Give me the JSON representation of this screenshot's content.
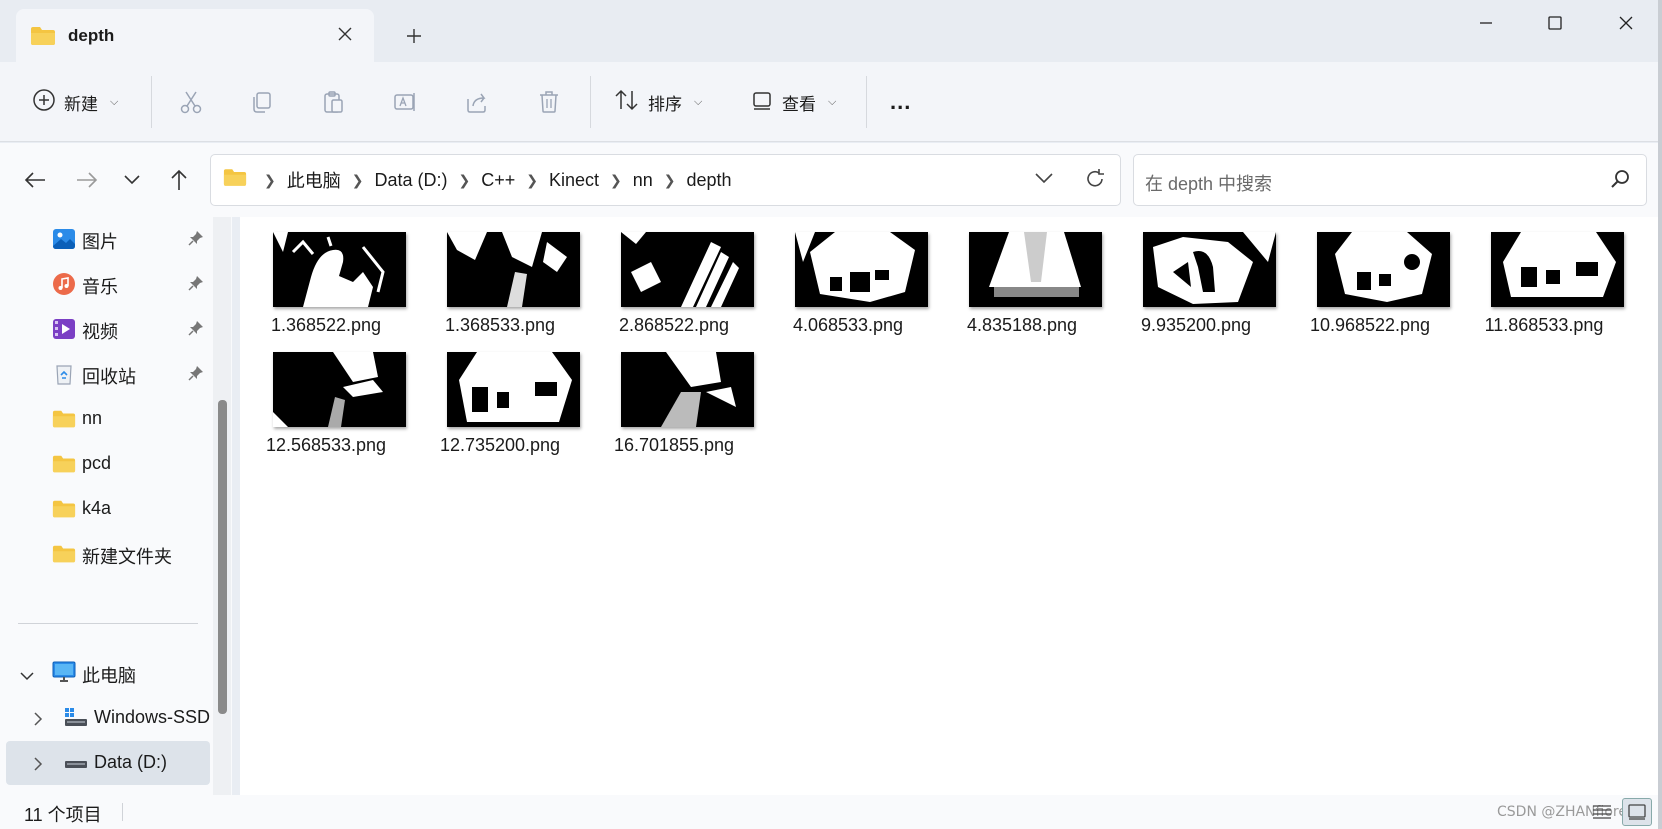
{
  "tab": {
    "title": "depth"
  },
  "toolbar": {
    "new_label": "新建",
    "sort_label": "排序",
    "view_label": "查看",
    "more_label": "..."
  },
  "address": {
    "crumbs": [
      "此电脑",
      "Data (D:)",
      "C++",
      "Kinect",
      "nn",
      "depth"
    ]
  },
  "search": {
    "placeholder": "在 depth 中搜索"
  },
  "sidebar": {
    "items": [
      {
        "label": "图片",
        "icon": "pictures-icon",
        "pinned": true
      },
      {
        "label": "音乐",
        "icon": "music-icon",
        "pinned": true
      },
      {
        "label": "视频",
        "icon": "videos-icon",
        "pinned": true
      },
      {
        "label": "回收站",
        "icon": "recycle-bin-icon",
        "pinned": true
      },
      {
        "label": "nn",
        "icon": "folder-icon",
        "pinned": false
      },
      {
        "label": "pcd",
        "icon": "folder-icon",
        "pinned": false
      },
      {
        "label": "k4a",
        "icon": "folder-icon",
        "pinned": false
      },
      {
        "label": "新建文件夹",
        "icon": "folder-icon",
        "pinned": false
      }
    ],
    "this_pc": {
      "label": "此电脑",
      "icon": "computer-icon"
    },
    "drives": [
      {
        "label": "Windows-SSD",
        "icon": "drive-icon"
      },
      {
        "label": "Data (D:)",
        "icon": "drive-icon",
        "selected": true
      }
    ]
  },
  "files": [
    {
      "name": "1.368522.png"
    },
    {
      "name": "1.368533.png"
    },
    {
      "name": "2.868522.png"
    },
    {
      "name": "4.068533.png"
    },
    {
      "name": "4.835188.png"
    },
    {
      "name": "9.935200.png"
    },
    {
      "name": "10.968522.png"
    },
    {
      "name": "11.868533.png"
    },
    {
      "name": "12.568533.png"
    },
    {
      "name": "12.735200.png"
    },
    {
      "name": "16.701855.png"
    }
  ],
  "status": {
    "item_count": "11 个项目"
  },
  "watermark": "CSDN @ZHANfioread",
  "colors": {
    "folder": "#f4c542",
    "accent": "#0067c0",
    "window_bg": "#e9edf3"
  }
}
